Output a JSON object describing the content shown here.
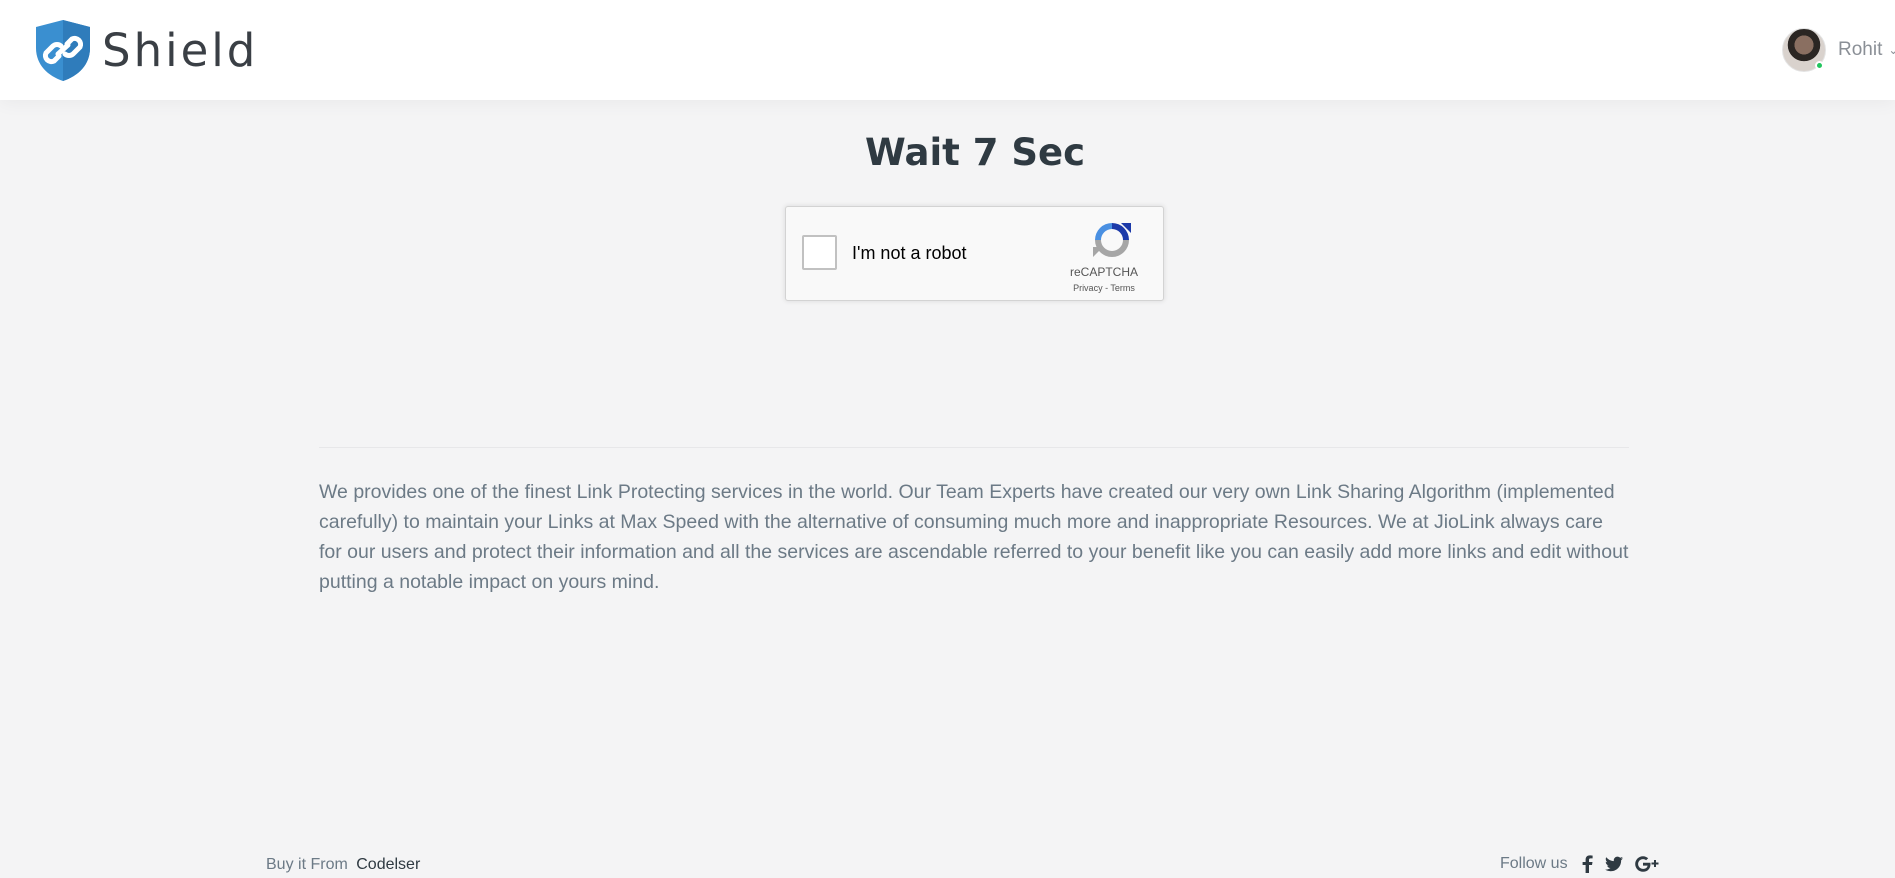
{
  "header": {
    "logo_text": "Shield",
    "user_name": "Rohit"
  },
  "main": {
    "title": "Wait 7 Sec",
    "captcha": {
      "label": "I'm not a robot",
      "brand": "reCAPTCHA",
      "privacy": "Privacy",
      "separator": " - ",
      "terms": "Terms"
    },
    "description": "We provides one of the finest Link Protecting services in the world. Our Team Experts have created our very own Link Sharing Algorithm (implemented carefully) to maintain your Links at Max Speed with the alternative of consuming much more and inappropriate Resources. We at JioLink always care for our users and protect their information and all the services are ascendable referred to your benefit like you can easily add more links and edit without putting a notable impact on yours mind."
  },
  "footer": {
    "buy_label": "Buy it From",
    "buy_link": "Codelser",
    "follow_label": "Follow us",
    "icons": [
      "facebook-icon",
      "twitter-icon",
      "google-plus-icon"
    ]
  },
  "colors": {
    "background": "#f4f4f5",
    "header": "#ffffff",
    "logo_blue": "#3a8fd0",
    "title": "#2f3a42",
    "text": "#6c7a86",
    "status_online": "#22c55e"
  }
}
